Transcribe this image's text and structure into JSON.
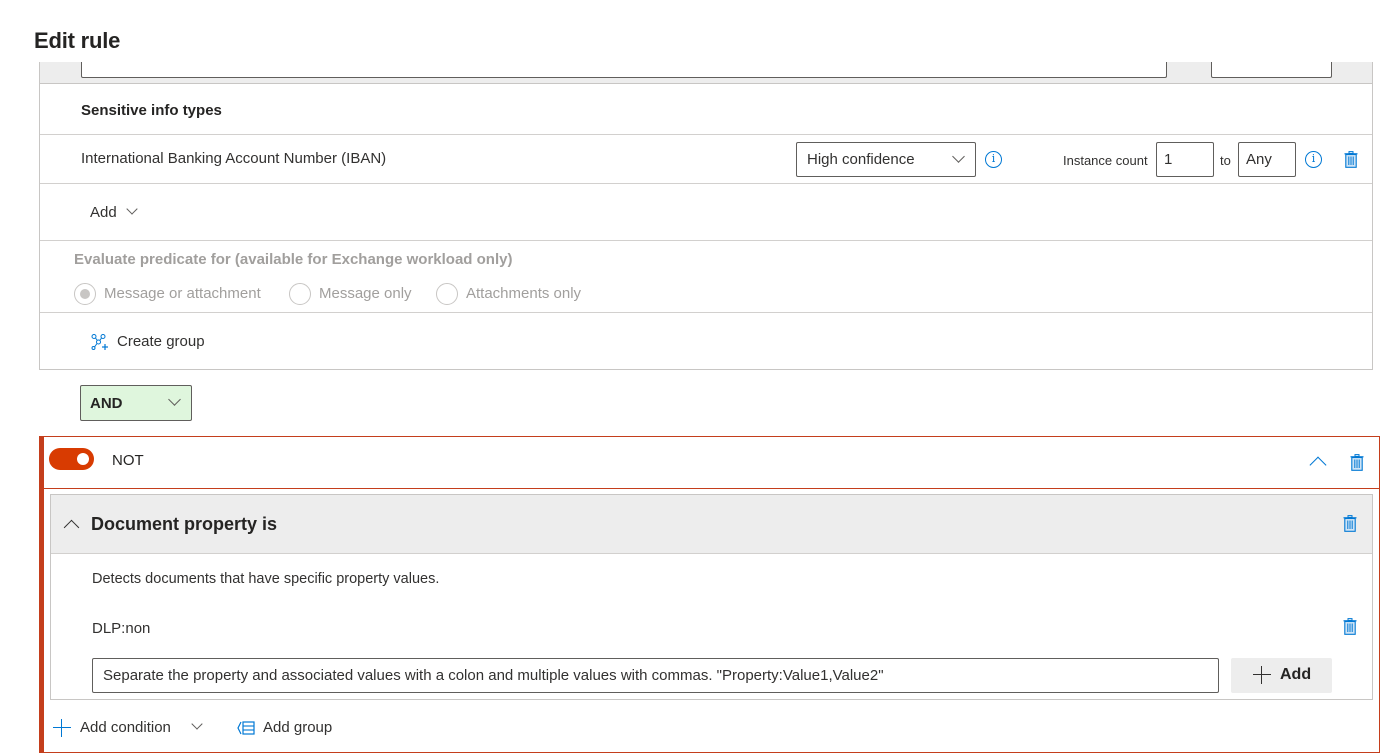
{
  "page": {
    "title": "Edit rule"
  },
  "sensitive_info": {
    "header": "Sensitive info types",
    "items": [
      {
        "name": "International Banking Account Number (IBAN)",
        "confidence": "High confidence",
        "instance_count_label": "Instance count",
        "min_count": "1",
        "to_label": "to",
        "max_count": "Any"
      }
    ],
    "add_label": "Add"
  },
  "evaluate": {
    "title": "Evaluate predicate for (available for Exchange workload only)",
    "options": [
      {
        "label": "Message or attachment",
        "selected": true
      },
      {
        "label": "Message only",
        "selected": false
      },
      {
        "label": "Attachments only",
        "selected": false
      }
    ],
    "disabled": true
  },
  "create_group_label": "Create group",
  "operator": {
    "value": "AND",
    "color": "#dff6dd"
  },
  "not_group": {
    "toggle_on": true,
    "label": "NOT",
    "accent": "#c43e1c",
    "condition": {
      "title": "Document property is",
      "description": "Detects documents that have specific property values.",
      "properties": [
        "DLP:non"
      ],
      "input_placeholder": "Separate the property and associated values with a colon and multiple values with commas. \"Property:Value1,Value2\"",
      "add_button": "Add"
    },
    "footer": {
      "add_condition": "Add condition",
      "add_group": "Add group"
    }
  }
}
